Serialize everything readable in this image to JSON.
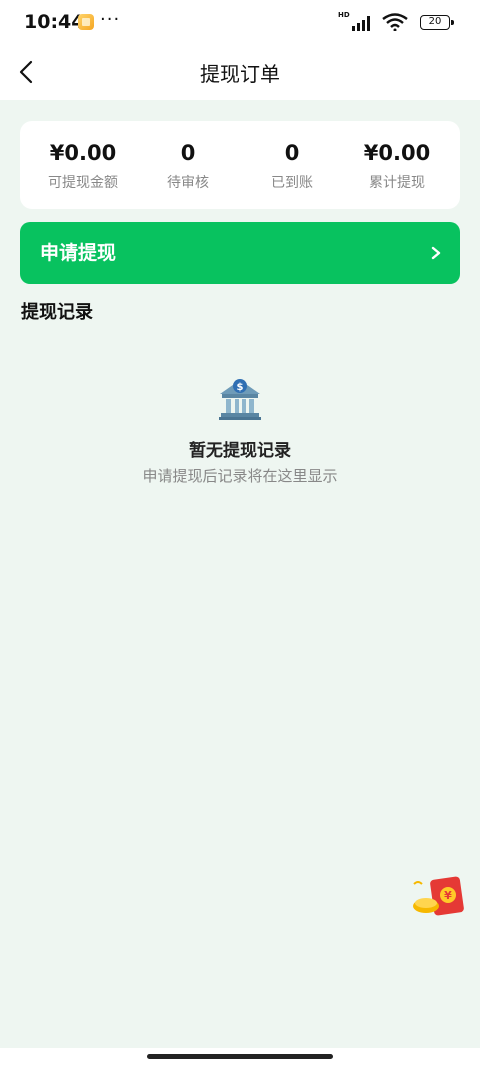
{
  "status_bar": {
    "time": "10:44",
    "dots": "···",
    "network": "HD",
    "battery": "20"
  },
  "nav": {
    "title": "提现订单"
  },
  "stats": [
    {
      "value": "¥0.00",
      "label": "可提现金额"
    },
    {
      "value": "0",
      "label": "待审核"
    },
    {
      "value": "0",
      "label": "已到账"
    },
    {
      "value": "¥0.00",
      "label": "累计提现"
    }
  ],
  "apply_button": {
    "label": "申请提现"
  },
  "records": {
    "section_title": "提现记录",
    "empty_title": "暂无提现记录",
    "empty_subtitle": "申请提现后记录将在这里显示"
  },
  "colors": {
    "accent": "#08c25f",
    "background": "#eef6f1"
  },
  "icons": [
    "back-arrow-icon",
    "chevron-right-icon",
    "bank-icon",
    "red-packet-icon"
  ]
}
